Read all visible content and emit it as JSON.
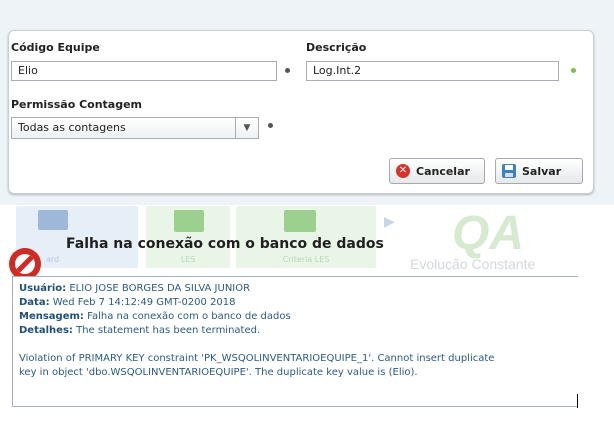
{
  "form": {
    "codigo_label": "Código Equipe",
    "codigo_value": "Elio",
    "descricao_label": "Descrição",
    "descricao_value": "Log.Int.2",
    "permissao_label": "Permissão Contagem",
    "permissao_value": "Todas as contagens",
    "cancel_label": "Cancelar",
    "save_label": "Salvar"
  },
  "background": {
    "tile_labels": [
      "ard",
      "LES",
      "Criteria LES"
    ],
    "logo": "QA",
    "tagline": "Evolução Constante"
  },
  "error": {
    "title": "Falha na conexão com o banco de dados",
    "usuario_label": "Usuário:",
    "usuario_value": "ELIO JOSE BORGES DA SILVA JUNIOR",
    "data_label": "Data:",
    "data_value": "Wed Feb 7 14:12:49 GMT-0200 2018",
    "mensagem_label": "Mensagem:",
    "mensagem_value": "Falha na conexão com o banco de dados",
    "detalhes_label": "Detalhes:",
    "detalhes_value": "The statement has been terminated.",
    "violation_line1": "Violation of PRIMARY KEY constraint 'PK_WSQOLINVENTARIOEQUIPE_1'. Cannot insert duplicate",
    "violation_line2": "key in object 'dbo.WSQOLINVENTARIOEQUIPE'. The duplicate key value is (Elio)."
  },
  "colors": {
    "accent": "#2b5b86",
    "error_red": "#d9322b",
    "valid_green": "#7bc043"
  }
}
